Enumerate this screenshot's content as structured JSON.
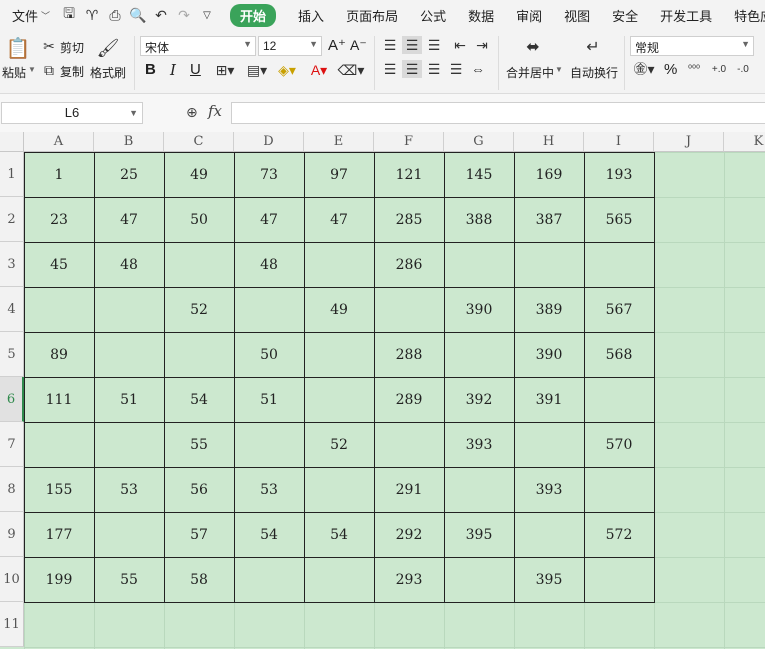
{
  "menubar": {
    "file": "文件",
    "tabs": [
      "开始",
      "插入",
      "页面布局",
      "公式",
      "数据",
      "审阅",
      "视图",
      "安全",
      "开发工具",
      "特色应"
    ]
  },
  "ribbon": {
    "paste": "粘贴",
    "cut": "剪切",
    "copy": "复制",
    "format_painter": "格式刷",
    "font_name": "宋体",
    "font_size": "12",
    "merge_center": "合并居中",
    "auto_wrap": "自动换行",
    "number_format": "常规",
    "bold": "B",
    "italic": "I",
    "underline": "U",
    "percent": "%",
    "increase_font": "A⁺",
    "decrease_font": "A⁻"
  },
  "formulabar": {
    "cell_ref": "L6",
    "fx": "fx",
    "formula": ""
  },
  "sheet": {
    "columns": [
      "A",
      "B",
      "C",
      "D",
      "E",
      "F",
      "G",
      "H",
      "I",
      "J",
      "K"
    ],
    "rows": [
      "1",
      "2",
      "3",
      "4",
      "5",
      "6",
      "7",
      "8",
      "9",
      "10",
      "11"
    ],
    "selected_row": "6",
    "cells": [
      [
        "1",
        "25",
        "49",
        "73",
        "97",
        "121",
        "145",
        "169",
        "193"
      ],
      [
        "23",
        "47",
        "50",
        "47",
        "47",
        "285",
        "388",
        "387",
        "565"
      ],
      [
        "45",
        "48",
        "",
        "48",
        "",
        "286",
        "",
        "",
        ""
      ],
      [
        "",
        "",
        "52",
        "",
        "49",
        "",
        "390",
        "389",
        "567"
      ],
      [
        "89",
        "",
        "",
        "50",
        "",
        "288",
        "",
        "390",
        "568"
      ],
      [
        "111",
        "51",
        "54",
        "51",
        "",
        "289",
        "392",
        "391",
        ""
      ],
      [
        "",
        "",
        "55",
        "",
        "52",
        "",
        "393",
        "",
        "570"
      ],
      [
        "155",
        "53",
        "56",
        "53",
        "",
        "291",
        "",
        "393",
        ""
      ],
      [
        "177",
        "",
        "57",
        "54",
        "54",
        "292",
        "395",
        "",
        "572"
      ],
      [
        "199",
        "55",
        "58",
        "",
        "",
        "293",
        "",
        "395",
        ""
      ]
    ]
  },
  "colors": {
    "sheet_bg": "#cce8cf",
    "accent": "#3aa35a"
  }
}
